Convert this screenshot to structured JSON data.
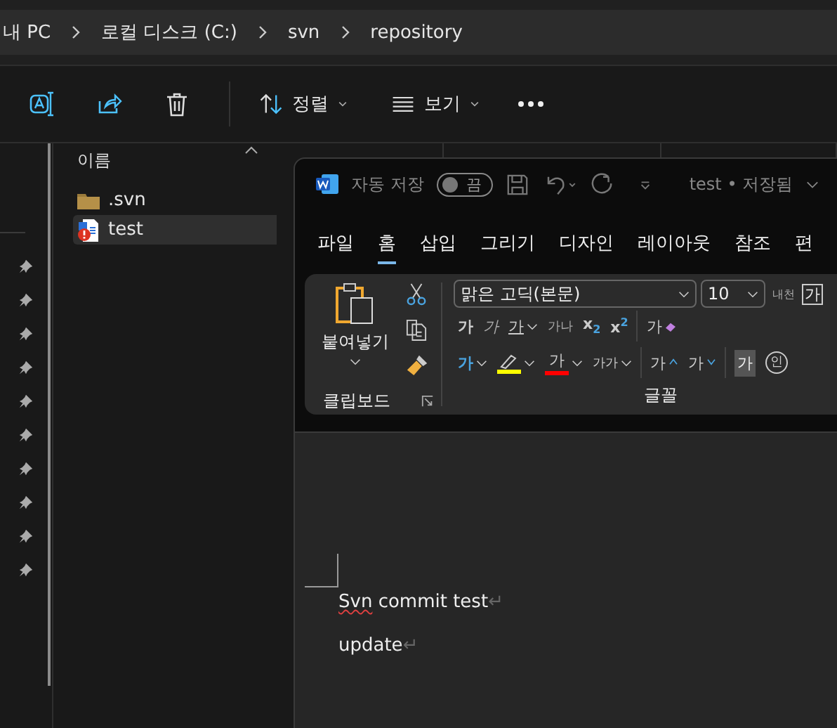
{
  "address_bar": {
    "crumbs": [
      "내 PC",
      "로컬 디스크 (C:)",
      "svn",
      "repository"
    ]
  },
  "toolbar": {
    "sort_label": "정렬",
    "view_label": "보기"
  },
  "file_list": {
    "column": "이름",
    "files": [
      {
        "name": ".svn",
        "kind": "folder",
        "selected": false
      },
      {
        "name": "test",
        "kind": "word_doc",
        "selected": true
      }
    ]
  },
  "word": {
    "autosave_label": "자동 저장",
    "autosave": {
      "on": false,
      "label": "끔"
    },
    "doc_title": "test • 저장됨",
    "tabs": [
      {
        "label": "파일",
        "selected": false
      },
      {
        "label": "홈",
        "selected": true
      },
      {
        "label": "삽입",
        "selected": false
      },
      {
        "label": "그리기",
        "selected": false
      },
      {
        "label": "디자인",
        "selected": false
      },
      {
        "label": "레이아웃",
        "selected": false
      },
      {
        "label": "참조",
        "selected": false
      },
      {
        "label": "편",
        "selected": false
      }
    ],
    "clipboard": {
      "paste_label": "붙여넣기",
      "group_label": "클립보드"
    },
    "font": {
      "name": "맑은 고딕(본문)",
      "size": "10",
      "phonetic": "내천",
      "boxed": "가",
      "group_label": "글꼴"
    },
    "format_row_1": [
      {
        "kind": "bold",
        "text": "가",
        "dropdown": false
      },
      {
        "kind": "italic",
        "text": "가",
        "dropdown": false
      },
      {
        "kind": "underline",
        "text": "가",
        "dropdown": true
      },
      {
        "kind": "strike",
        "text": "가나",
        "dropdown": false
      },
      {
        "kind": "subscript",
        "text": "x$_{2}$",
        "dropdown": false
      },
      {
        "kind": "superscript",
        "text": "x$^{2}$",
        "dropdown": false
      },
      {
        "kind": "clear",
        "text": "가",
        "dropdown": false
      }
    ],
    "format_row_2": [
      {
        "kind": "effects",
        "text": "가",
        "dropdown": true
      },
      {
        "kind": "highlight",
        "color": "#ffff00",
        "dropdown": true
      },
      {
        "kind": "font_color",
        "text": "가",
        "color": "#ff0000",
        "dropdown": true
      },
      {
        "kind": "change_case",
        "text": "가가",
        "dropdown": true
      },
      {
        "kind": "grow",
        "text": "가",
        "dropdown": false
      },
      {
        "kind": "shrink",
        "text": "가",
        "dropdown": false
      },
      {
        "kind": "shading",
        "text": "가",
        "dropdown": false
      },
      {
        "kind": "enclose",
        "text": "인",
        "dropdown": false
      }
    ],
    "document": {
      "paragraphs": [
        {
          "parts": [
            {
              "text": "Svn",
              "misspelled": true
            },
            {
              "text": " commit test",
              "misspelled": false
            }
          ],
          "mark": "↵"
        },
        {
          "parts": [
            {
              "text": "update",
              "misspelled": false
            }
          ],
          "mark": "↵"
        }
      ]
    }
  }
}
